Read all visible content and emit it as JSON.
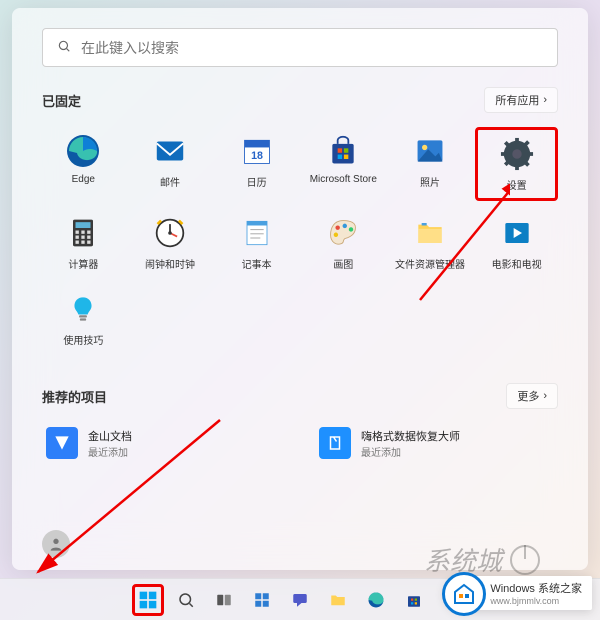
{
  "search": {
    "placeholder": "在此键入以搜索"
  },
  "pinned": {
    "title": "已固定",
    "all_apps_btn": "所有应用",
    "apps": [
      {
        "label": "Edge",
        "icon": "edge"
      },
      {
        "label": "邮件",
        "icon": "mail"
      },
      {
        "label": "日历",
        "icon": "calendar"
      },
      {
        "label": "Microsoft Store",
        "icon": "store"
      },
      {
        "label": "照片",
        "icon": "photos"
      },
      {
        "label": "设置",
        "icon": "settings",
        "highlight": true
      },
      {
        "label": "计算器",
        "icon": "calculator"
      },
      {
        "label": "闹钟和时钟",
        "icon": "clock"
      },
      {
        "label": "记事本",
        "icon": "notepad"
      },
      {
        "label": "画图",
        "icon": "paint"
      },
      {
        "label": "文件资源管理器",
        "icon": "explorer"
      },
      {
        "label": "电影和电视",
        "icon": "movies"
      },
      {
        "label": "使用技巧",
        "icon": "tips"
      }
    ]
  },
  "recommended": {
    "title": "推荐的项目",
    "more_btn": "更多",
    "items": [
      {
        "title": "金山文档",
        "subtitle": "最近添加",
        "icon": "wps",
        "color": "#2d7ff9"
      },
      {
        "title": "嗨格式数据恢复大师",
        "subtitle": "最近添加",
        "icon": "recovery",
        "color": "#1e90ff"
      }
    ]
  },
  "watermark": {
    "title": "Windows 系统之家",
    "url": "www.bjmmlv.com"
  },
  "watermark_cn": "系统城"
}
